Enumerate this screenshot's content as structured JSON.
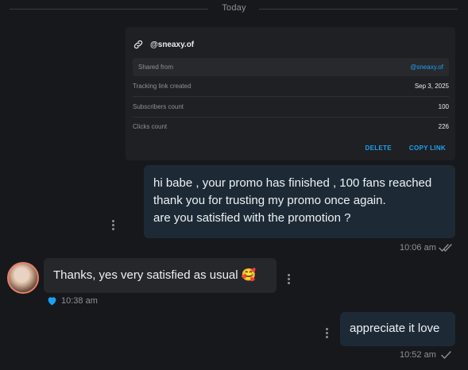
{
  "divider": {
    "label": "Today"
  },
  "tracking_card": {
    "title": "@sneaxy.of",
    "rows": [
      {
        "label": "Shared from",
        "value": "@sneaxy.of"
      },
      {
        "label": "Tracking link created",
        "value": "Sep 3, 2025"
      },
      {
        "label": "Subscribers count",
        "value": "100"
      },
      {
        "label": "Clicks count",
        "value": "226"
      }
    ],
    "actions": {
      "delete": "DELETE",
      "copy": "COPY LINK"
    }
  },
  "messages": [
    {
      "direction": "out",
      "lines": [
        "hi babe , your promo has finished , 100 fans reached",
        "thank you for trusting my promo once again.",
        "are you satisfied with the promotion ?"
      ],
      "time": "10:06 am",
      "status": "read-double-check-icon"
    },
    {
      "direction": "in",
      "text": "Thanks, yes very satisfied as usual 🥰",
      "time": "10:38 am",
      "liked": true
    },
    {
      "direction": "out",
      "text": "appreciate it love",
      "time": "10:52 am",
      "status": "sent-check-icon"
    }
  ],
  "colors": {
    "accent": "#1da1f2",
    "background": "#17181b",
    "bubble_out": "#1d2a36",
    "bubble_in": "#26272b"
  }
}
